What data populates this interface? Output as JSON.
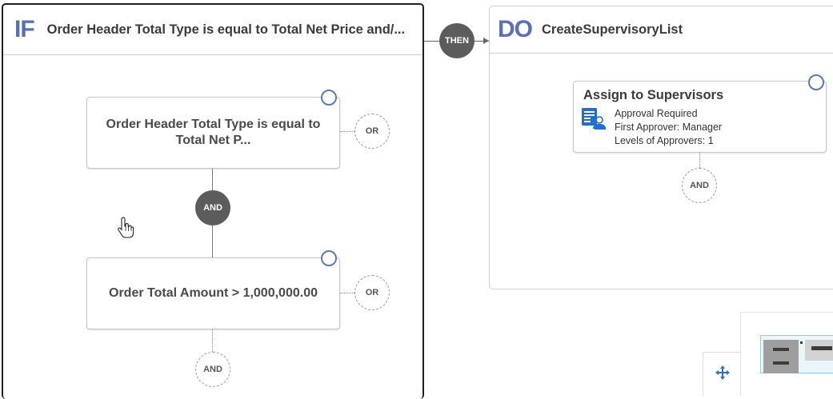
{
  "if_panel": {
    "keyword": "IF",
    "title": "Order Header Total Type is equal to Total Net Price and/..."
  },
  "connector": {
    "label": "THEN"
  },
  "do_panel": {
    "keyword": "DO",
    "title": "CreateSupervisoryList"
  },
  "conditions": [
    {
      "text": "Order Header Total Type is equal to Total Net P...",
      "or_label": "OR"
    },
    {
      "text": "Order Total Amount > 1,000,000.00",
      "or_label": "OR"
    }
  ],
  "and_operator": "AND",
  "add_and_label": "AND",
  "action": {
    "title": "Assign to Supervisors",
    "lines": [
      "Approval Required",
      "First Approver: Manager",
      "Levels of Approvers: 1"
    ],
    "icon": "approval-document-person-icon",
    "and_label": "AND"
  },
  "icons": {
    "move": "move-arrows-icon",
    "cursor": "hand-pointer-icon"
  },
  "colors": {
    "keyword": "#5b6fb5",
    "handle": "#5a7bb0",
    "operator_fill": "#5c5c5c",
    "move_icon": "#2a6fc4",
    "action_icon": "#1e6fd0",
    "minimap_highlight": "#8ecdf0"
  }
}
